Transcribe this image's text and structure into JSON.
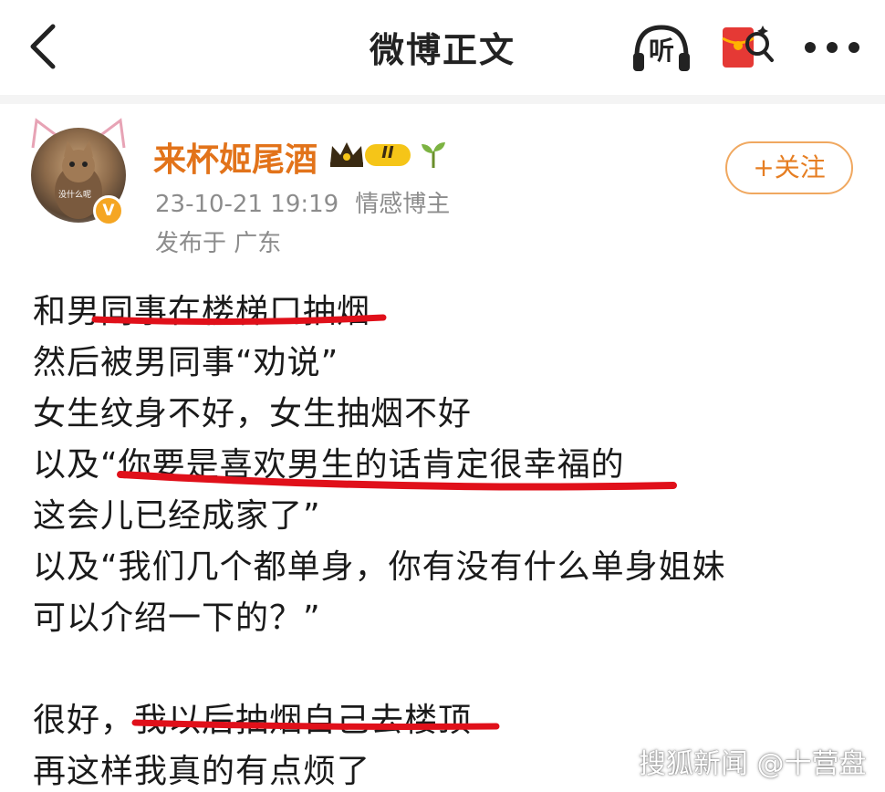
{
  "nav": {
    "title": "微博正文",
    "listen_label": "听",
    "back_icon": "chevron-left-icon",
    "redpacket_icon": "red-envelope-search-icon",
    "more_icon": "more-dots-icon"
  },
  "author": {
    "name": "来杯姬尾酒",
    "avatar_caption": "没什么呢",
    "verified_mark": "V",
    "level_badge": "II",
    "timestamp": "23-10-21 19:19",
    "role": "情感博主",
    "location": "发布于 广东",
    "follow_label": "+关注"
  },
  "post": {
    "lines": [
      "和男同事在楼梯口抽烟",
      "然后被男同事“劝说”",
      "女生纹身不好，女生抽烟不好",
      "以及“你要是喜欢男生的话肯定很幸福的",
      "这会儿已经成家了”",
      "以及“我们几个都单身，你有没有什么单身姐妹",
      "可以介绍一下的？”",
      "",
      "很好，我以后抽烟自己去楼顶",
      "再这样我真的有点烦了"
    ]
  },
  "watermark": "搜狐新闻 @十营盘",
  "colors": {
    "username": "#e2731a",
    "follow_border": "#f0a860",
    "underline": "#e0101a",
    "meta_text": "#8c8c8c"
  }
}
